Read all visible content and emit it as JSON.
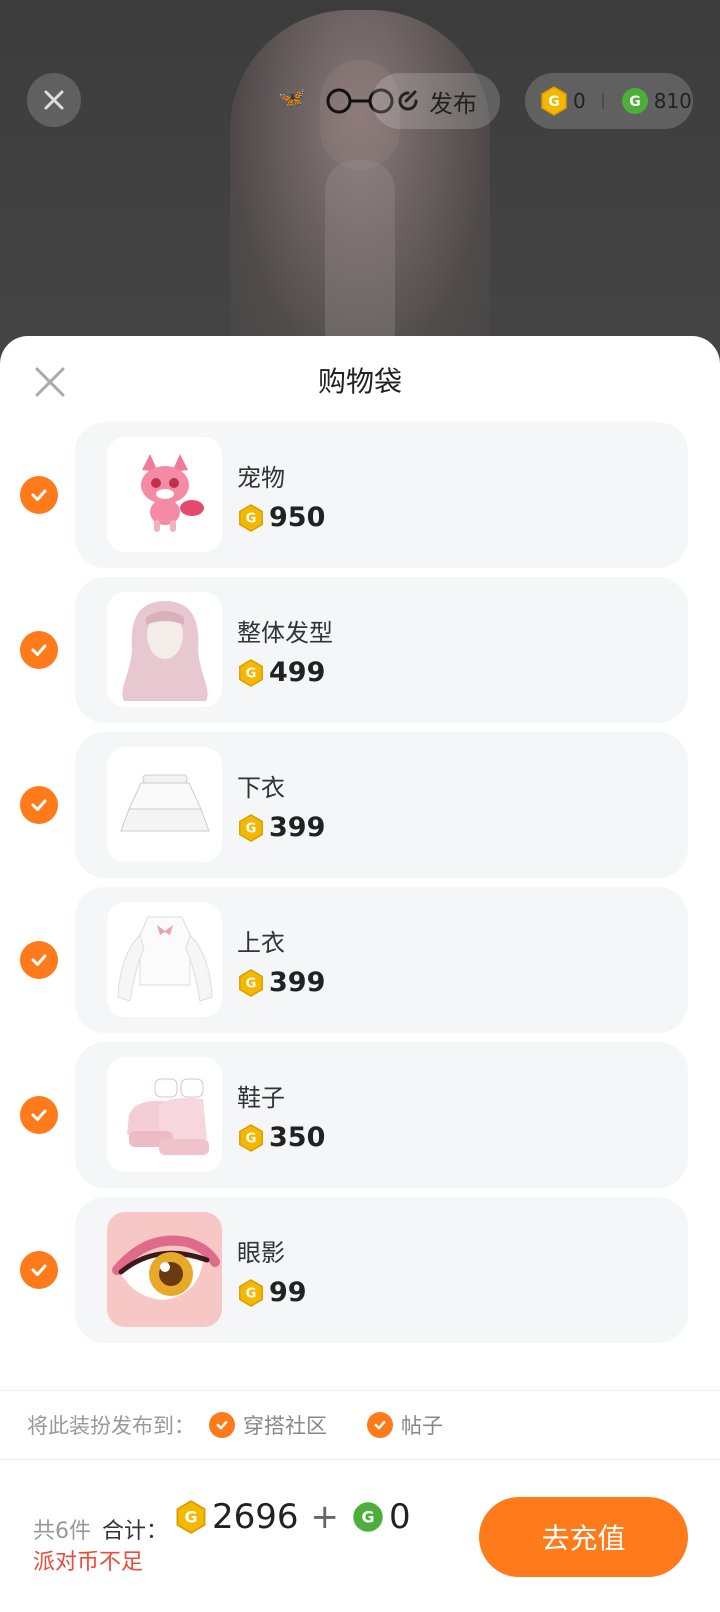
{
  "header": {
    "publish_label": "发布",
    "coin_gold": "0",
    "coin_green": "810"
  },
  "sheet": {
    "title": "购物袋"
  },
  "items": [
    {
      "name": "宠物",
      "price": "950",
      "thumb": "pet-fox"
    },
    {
      "name": "整体发型",
      "price": "499",
      "thumb": "hairstyle"
    },
    {
      "name": "下衣",
      "price": "399",
      "thumb": "skirt"
    },
    {
      "name": "上衣",
      "price": "399",
      "thumb": "blouse"
    },
    {
      "name": "鞋子",
      "price": "350",
      "thumb": "shoes"
    },
    {
      "name": "眼影",
      "price": "99",
      "thumb": "eyeshadow"
    }
  ],
  "publish_to": {
    "label": "将此装扮发布到：",
    "options": [
      "穿搭社区",
      "帖子"
    ]
  },
  "footer": {
    "count": "共6件",
    "total_label": "合计：",
    "total_gold": "2696",
    "plus": "+",
    "total_green": "0",
    "warning": "派对币不足",
    "recharge_label": "去充值"
  },
  "colors": {
    "accent": "#ff7a1a",
    "gold_coin": "#f5b800",
    "green_coin": "#4caf3a",
    "warning": "#f04a3a"
  }
}
